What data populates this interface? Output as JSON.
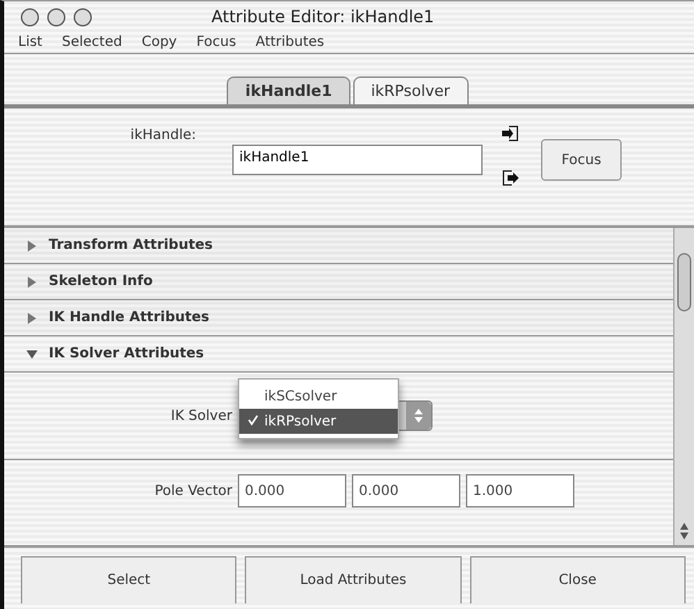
{
  "window": {
    "title": "Attribute Editor: ikHandle1"
  },
  "menu": [
    "List",
    "Selected",
    "Copy",
    "Focus",
    "Attributes"
  ],
  "tabs": [
    {
      "label": "ikHandle1",
      "selected": true
    },
    {
      "label": "ikRPsolver",
      "selected": false
    }
  ],
  "node": {
    "label": "ikHandle:",
    "value": "ikHandle1",
    "focus_button": "Focus"
  },
  "sections": [
    {
      "title": "Transform Attributes",
      "expanded": false
    },
    {
      "title": "Skeleton Info",
      "expanded": false
    },
    {
      "title": "IK Handle Attributes",
      "expanded": false
    },
    {
      "title": "IK Solver Attributes",
      "expanded": true
    }
  ],
  "ik_solver": {
    "label": "IK Solver",
    "options": [
      {
        "label": "ikSCsolver",
        "selected": false
      },
      {
        "label": "ikRPsolver",
        "selected": true
      }
    ]
  },
  "pole_vector": {
    "label": "Pole Vector",
    "values": [
      "0.000",
      "0.000",
      "1.000"
    ]
  },
  "buttons": [
    "Select",
    "Load Attributes",
    "Close"
  ]
}
